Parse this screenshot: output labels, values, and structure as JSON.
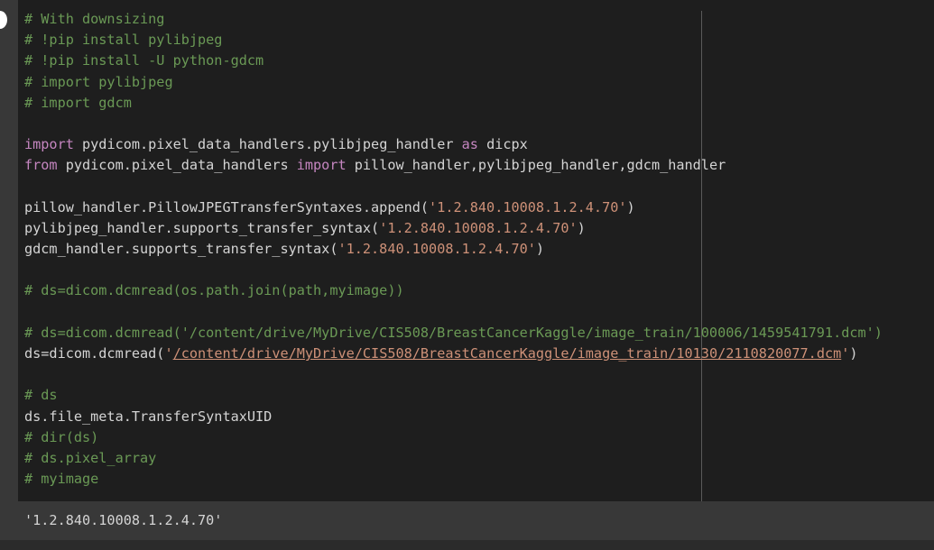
{
  "code": {
    "l1": "# With downsizing",
    "l2": "# !pip install pylibjpeg",
    "l3": "# !pip install -U python-gdcm",
    "l4": "# import pylibjpeg",
    "l5": "# import gdcm",
    "l7_kw1": "import",
    "l7_mid": " pydicom.pixel_data_handlers.pylibjpeg_handler ",
    "l7_kw2": "as",
    "l7_end": " dicpx",
    "l8_kw1": "from",
    "l8_mid": " pydicom.pixel_data_handlers ",
    "l8_kw2": "import",
    "l8_end": " pillow_handler,pylibjpeg_handler,gdcm_handler",
    "l10_pre": "pillow_handler.PillowJPEGTransferSyntaxes.append(",
    "l10_str": "'1.2.840.10008.1.2.4.70'",
    "l10_post": ")",
    "l11_pre": "pylibjpeg_handler.supports_transfer_syntax(",
    "l11_str": "'1.2.840.10008.1.2.4.70'",
    "l11_post": ")",
    "l12_pre": "gdcm_handler.supports_transfer_syntax(",
    "l12_str": "'1.2.840.10008.1.2.4.70'",
    "l12_post": ")",
    "l14": "# ds=dicom.dcmread(os.path.join(path,myimage))",
    "l16": "# ds=dicom.dcmread('/content/drive/MyDrive/CIS508/BreastCancerKaggle/image_train/100006/1459541791.dcm')",
    "l17_pre": "ds=dicom.dcmread(",
    "l17_q1": "'",
    "l17_path": "/content/drive/MyDrive/CIS508/BreastCancerKaggle/image_train/10130/2110820077.dcm",
    "l17_q2": "'",
    "l17_post": ")",
    "l19": "# ds",
    "l20": "ds.file_meta.TransferSyntaxUID",
    "l21": "# dir(ds)",
    "l22": "# ds.pixel_array",
    "l23": "# myimage"
  },
  "output": {
    "text": "'1.2.840.10008.1.2.4.70'"
  },
  "colors": {
    "editor_bg": "#1e1e1e",
    "comment": "#6a9955",
    "keyword": "#c586c0",
    "string": "#ce9178",
    "text": "#d4d4d4"
  }
}
